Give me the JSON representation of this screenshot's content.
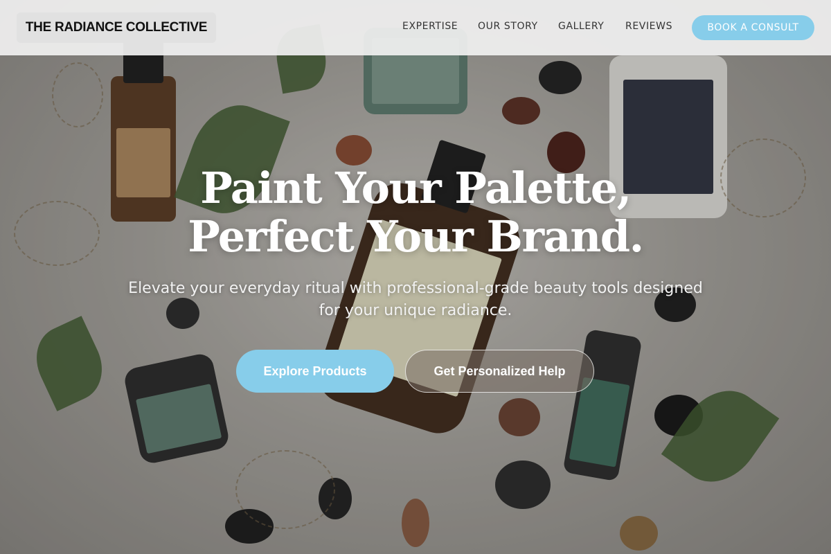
{
  "brand": {
    "name": "THE RADIANCE COLLECTIVE"
  },
  "nav": {
    "links": [
      "EXPERTISE",
      "OUR STORY",
      "GALLERY",
      "REVIEWS"
    ],
    "cta": "BOOK A CONSULT"
  },
  "hero": {
    "headline_line1": "Paint Your Palette,",
    "headline_line2": "Perfect Your Brand.",
    "subheadline": "Elevate your everyday ritual with professional-grade beauty tools designed for your unique radiance.",
    "primary_button": "Explore Products",
    "secondary_button": "Get Personalized Help"
  },
  "colors": {
    "accent": "#87cdea",
    "nav_background": "#f0f0f0",
    "headline_text": "#ffffff"
  }
}
